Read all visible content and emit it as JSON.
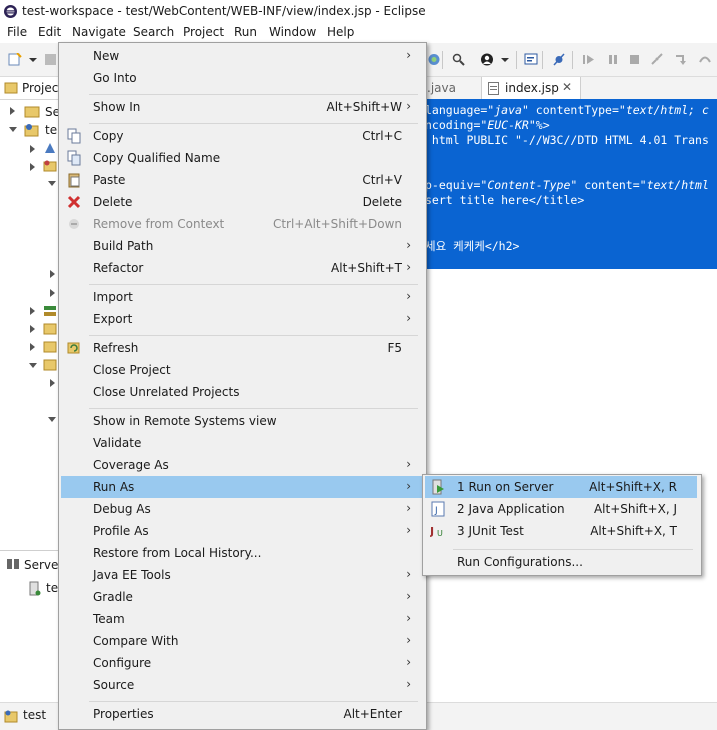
{
  "window": {
    "title": "test-workspace - test/WebContent/WEB-INF/view/index.jsp - Eclipse"
  },
  "menubar": [
    "File",
    "Edit",
    "Navigate",
    "Search",
    "Project",
    "Run",
    "Window",
    "Help"
  ],
  "explorer": {
    "tab": "Projec",
    "items": [
      "Se",
      "te"
    ]
  },
  "editor": {
    "tabs": [
      {
        "label": ".java"
      },
      {
        "label": "index.jsp"
      }
    ],
    "lines": [
      {
        "parts": [
          {
            "t": "language=\""
          },
          {
            "t": "java",
            "i": true
          },
          {
            "t": "\" contentType=\""
          },
          {
            "t": "text/html; c",
            "i": true
          }
        ]
      },
      {
        "parts": [
          {
            "t": "ncoding=\""
          },
          {
            "t": "EUC-KR",
            "i": true
          },
          {
            "t": "\"%>"
          }
        ]
      },
      {
        "parts": [
          {
            "t": " html PUBLIC \"-//W3C//DTD HTML 4.01 Trans"
          }
        ]
      },
      {
        "parts": [
          {
            "t": ""
          }
        ]
      },
      {
        "parts": [
          {
            "t": "p-equiv=\""
          },
          {
            "t": "Content-Type",
            "i": true
          },
          {
            "t": "\" content=\""
          },
          {
            "t": "text/html",
            "i": true
          }
        ]
      },
      {
        "parts": [
          {
            "t": "sert title here</title>"
          }
        ]
      },
      {
        "parts": [
          {
            "t": ""
          }
        ]
      },
      {
        "parts": [
          {
            "t": ""
          }
        ]
      },
      {
        "parts": [
          {
            "t": "세요 케케케</h2>"
          }
        ]
      }
    ]
  },
  "servers": {
    "tab": "Server",
    "item": "te"
  },
  "statusbar": {
    "project": "test"
  },
  "context_menu": [
    {
      "label": "New",
      "submenu": true
    },
    {
      "label": "Go Into"
    },
    {
      "sep": true
    },
    {
      "label": "Show In",
      "shortcut": "Alt+Shift+W",
      "submenu": true
    },
    {
      "sep": true
    },
    {
      "label": "Copy",
      "shortcut": "Ctrl+C",
      "icon": "copy-icon"
    },
    {
      "label": "Copy Qualified Name",
      "icon": "copy-qualified-icon"
    },
    {
      "label": "Paste",
      "shortcut": "Ctrl+V",
      "icon": "paste-icon"
    },
    {
      "label": "Delete",
      "shortcut": "Delete",
      "icon": "delete-icon"
    },
    {
      "label": "Remove from Context",
      "shortcut": "Ctrl+Alt+Shift+Down",
      "icon": "remove-context-icon",
      "disabled": true
    },
    {
      "label": "Build Path",
      "submenu": true
    },
    {
      "label": "Refactor",
      "shortcut": "Alt+Shift+T",
      "submenu": true
    },
    {
      "sep": true
    },
    {
      "label": "Import",
      "submenu": true
    },
    {
      "label": "Export",
      "submenu": true
    },
    {
      "sep": true
    },
    {
      "label": "Refresh",
      "shortcut": "F5",
      "icon": "refresh-icon"
    },
    {
      "label": "Close Project"
    },
    {
      "label": "Close Unrelated Projects"
    },
    {
      "sep": true
    },
    {
      "label": "Show in Remote Systems view"
    },
    {
      "label": "Validate"
    },
    {
      "label": "Coverage As",
      "submenu": true
    },
    {
      "label": "Run As",
      "submenu": true,
      "highlighted": true
    },
    {
      "label": "Debug As",
      "submenu": true
    },
    {
      "label": "Profile As",
      "submenu": true
    },
    {
      "label": "Restore from Local History..."
    },
    {
      "label": "Java EE Tools",
      "submenu": true
    },
    {
      "label": "Gradle",
      "submenu": true
    },
    {
      "label": "Team",
      "submenu": true
    },
    {
      "label": "Compare With",
      "submenu": true
    },
    {
      "label": "Configure",
      "submenu": true
    },
    {
      "label": "Source",
      "submenu": true
    },
    {
      "sep": true
    },
    {
      "label": "Properties",
      "shortcut": "Alt+Enter"
    }
  ],
  "run_as_submenu": [
    {
      "label": "1 Run on Server",
      "shortcut": "Alt+Shift+X, R",
      "icon": "run-on-server-icon",
      "highlighted": true
    },
    {
      "label": "2 Java Application",
      "shortcut": "Alt+Shift+X, J",
      "icon": "java-application-icon"
    },
    {
      "label": "3 JUnit Test",
      "shortcut": "Alt+Shift+X, T",
      "icon": "junit-icon"
    },
    {
      "sep": true
    },
    {
      "label": "Run Configurations..."
    }
  ],
  "colors": {
    "menu_highlight": "#99c9ef",
    "editor_selection": "#0a64d2",
    "menu_bg": "#f0f0f0"
  }
}
